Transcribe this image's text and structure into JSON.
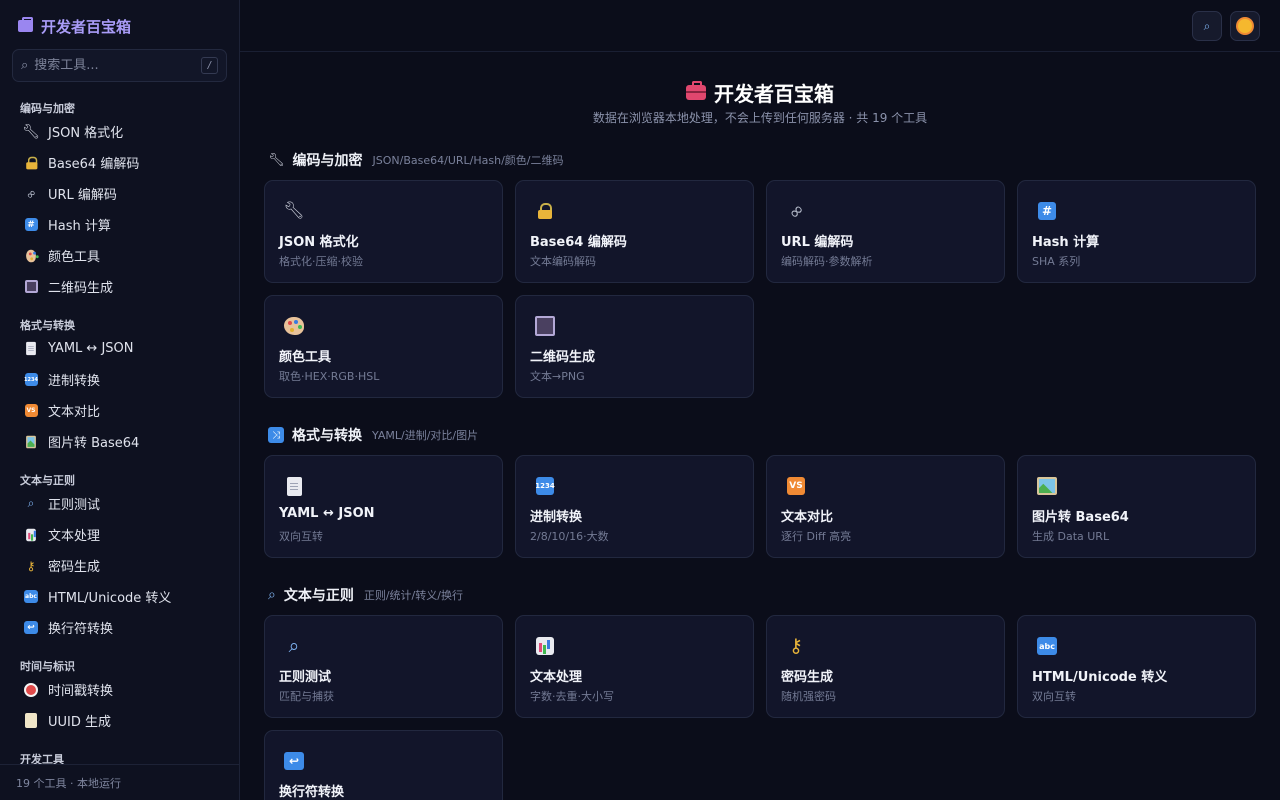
{
  "app": {
    "title": "开发者百宝箱",
    "search_placeholder": "搜索工具...",
    "search_shortcut": "/",
    "footer": "19 个工具 · 本地运行"
  },
  "sidebar": {
    "groups": [
      {
        "title": "编码与加密",
        "items": [
          {
            "label": "JSON 格式化",
            "icon": "wrench-icon"
          },
          {
            "label": "Base64 编解码",
            "icon": "lock-icon"
          },
          {
            "label": "URL 编解码",
            "icon": "link-icon"
          },
          {
            "label": "Hash 计算",
            "icon": "hash-icon"
          },
          {
            "label": "颜色工具",
            "icon": "palette-icon"
          },
          {
            "label": "二维码生成",
            "icon": "qr-icon"
          }
        ]
      },
      {
        "title": "格式与转换",
        "items": [
          {
            "label": "YAML ↔ JSON",
            "icon": "document-icon"
          },
          {
            "label": "进制转换",
            "icon": "numbers-icon"
          },
          {
            "label": "文本对比",
            "icon": "vs-icon"
          },
          {
            "label": "图片转 Base64",
            "icon": "image-icon"
          }
        ]
      },
      {
        "title": "文本与正则",
        "items": [
          {
            "label": "正则测试",
            "icon": "magnifier-icon"
          },
          {
            "label": "文本处理",
            "icon": "bar-chart-icon"
          },
          {
            "label": "密码生成",
            "icon": "key-icon"
          },
          {
            "label": "HTML/Unicode 转义",
            "icon": "abc-icon"
          },
          {
            "label": "换行符转换",
            "icon": "return-icon"
          }
        ]
      },
      {
        "title": "时间与标识",
        "items": [
          {
            "label": "时间戳转换",
            "icon": "alarm-clock-icon"
          },
          {
            "label": "UUID 生成",
            "icon": "memo-icon"
          }
        ]
      },
      {
        "title": "开发工具",
        "items": []
      }
    ]
  },
  "topbar": {
    "search_button_icon": "search-icon",
    "theme_button_icon": "sun-icon"
  },
  "hero": {
    "title": "开发者百宝箱",
    "subtitle": "数据在浏览器本地处理，不会上传到任何服务器 · 共 19 个工具"
  },
  "sections": [
    {
      "title": "编码与加密",
      "tags": "JSON/Base64/URL/Hash/颜色/二维码",
      "cards": [
        {
          "title": "JSON 格式化",
          "desc": "格式化·压缩·校验"
        },
        {
          "title": "Base64 编解码",
          "desc": "文本编码解码"
        },
        {
          "title": "URL 编解码",
          "desc": "编码解码·参数解析"
        },
        {
          "title": "Hash 计算",
          "desc": "SHA 系列"
        },
        {
          "title": "颜色工具",
          "desc": "取色·HEX·RGB·HSL"
        },
        {
          "title": "二维码生成",
          "desc": "文本→PNG"
        }
      ]
    },
    {
      "title": "格式与转换",
      "tags": "YAML/进制/对比/图片",
      "cards": [
        {
          "title": "YAML ↔ JSON",
          "desc": "双向互转"
        },
        {
          "title": "进制转换",
          "desc": "2/8/10/16·大数"
        },
        {
          "title": "文本对比",
          "desc": "逐行 Diff 高亮"
        },
        {
          "title": "图片转 Base64",
          "desc": "生成 Data URL"
        }
      ]
    },
    {
      "title": "文本与正则",
      "tags": "正则/统计/转义/换行",
      "cards": [
        {
          "title": "正则测试",
          "desc": "匹配与捕获"
        },
        {
          "title": "文本处理",
          "desc": "字数·去重·大小写"
        },
        {
          "title": "密码生成",
          "desc": "随机强密码"
        },
        {
          "title": "HTML/Unicode 转义",
          "desc": "双向互转"
        },
        {
          "title": "换行符转换",
          "desc": ""
        }
      ]
    }
  ],
  "icon_glyphs": {
    "numbers": "1234",
    "vs": "VS",
    "abc": "abc",
    "hash": "#"
  },
  "colors": {
    "background": "#0b0d1a",
    "sidebar": "#0e1120",
    "card": "#12152a",
    "brand": "#a99cf7"
  }
}
